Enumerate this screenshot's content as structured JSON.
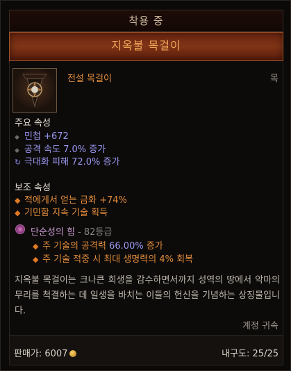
{
  "header": {
    "equipped_label": "착용 중"
  },
  "item": {
    "name": "지옥불 목걸이",
    "rarity_type": "전설 목걸이",
    "slot": "목",
    "icon": "amulet-icon"
  },
  "primary": {
    "title": "주요 속성",
    "stats": [
      {
        "icon": "diamond-bullet",
        "text": "민첩 +672"
      },
      {
        "icon": "diamond-bullet",
        "text": "공격 속도 7.0% 증가"
      },
      {
        "icon": "swirl-bullet",
        "text": "극대화 피해 72.0% 증가"
      }
    ]
  },
  "secondary": {
    "title": "보조 속성",
    "stats": [
      {
        "icon": "orange-diamond-bullet",
        "text": "적에게서 얻는 금화 +74%"
      },
      {
        "icon": "orange-diamond-bullet",
        "text": "기민함 지속 기술 획득"
      }
    ]
  },
  "aspect": {
    "icon": "aspect-icon",
    "name": "단순성의 힘",
    "level": " - 82등급",
    "lines": [
      {
        "prefix": "주 기술의 공격력 ",
        "value": "66.00%",
        "suffix": " 증가"
      },
      {
        "prefix": "주 기술 적중 시 최대 생명력의 ",
        "value": "4%",
        "suffix": " 회복"
      }
    ]
  },
  "flavor": "지옥불 목걸이는 크나큰 희생을 감수하면서까지 성역의 땅에서 악마의 무리를 척결하는 데 일생을 바치는 이들의 헌신을 기념하는 상징물입니다.",
  "account_bound": "계정 귀속",
  "footer": {
    "price_label": "판매가: 6007",
    "durability_label": "내구도: 25/25",
    "gold_icon": "gold-coin-icon"
  },
  "colors": {
    "legendary_orange": "#e38d3c",
    "stat_blue": "#9a98f0",
    "banner_red": "#7e3416"
  }
}
